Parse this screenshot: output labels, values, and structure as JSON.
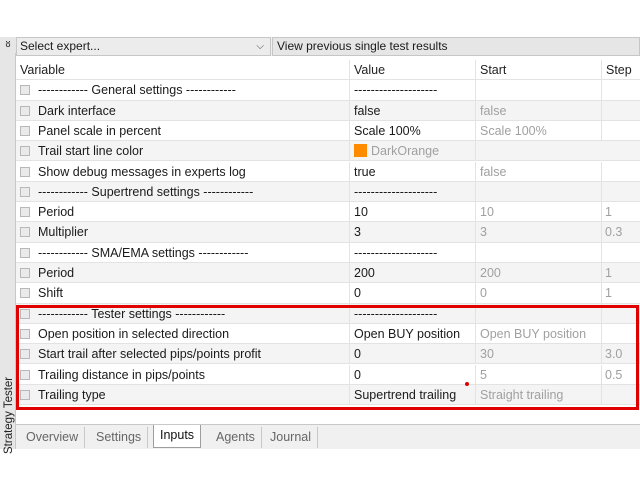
{
  "window": {
    "side_title": "Strategy Tester",
    "close_glyph": "ᴕ"
  },
  "toolbar": {
    "expert_select": "Select expert...",
    "view_results_button": "View previous single test results"
  },
  "table": {
    "headers": [
      "Variable",
      "Value",
      "Start",
      "Step"
    ],
    "rows": [
      {
        "variable": "------------ General settings ------------",
        "value": "--------------------",
        "start": "",
        "step": ""
      },
      {
        "variable": "Dark interface",
        "value": "false",
        "start": "false",
        "step": ""
      },
      {
        "variable": "Panel scale in percent",
        "value": "Scale 100%",
        "start": "Scale 100%",
        "step": ""
      },
      {
        "variable": "Trail start line color",
        "value": "",
        "start": "DarkOrange",
        "step": ""
      },
      {
        "variable": "Show debug messages in experts log",
        "value": "true",
        "start": "false",
        "step": ""
      },
      {
        "variable": "------------ Supertrend settings ------------",
        "value": "--------------------",
        "start": "",
        "step": ""
      },
      {
        "variable": "Period",
        "value": "10",
        "start": "10",
        "step": "1"
      },
      {
        "variable": "Multiplier",
        "value": "3",
        "start": "3",
        "step": "0.3"
      },
      {
        "variable": "------------ SMA/EMA settings ------------",
        "value": "--------------------",
        "start": "",
        "step": ""
      },
      {
        "variable": "Period",
        "value": "200",
        "start": "200",
        "step": "1"
      },
      {
        "variable": "Shift",
        "value": "0",
        "start": "0",
        "step": "1"
      },
      {
        "variable": "------------ Tester settings ------------",
        "value": "--------------------",
        "start": "",
        "step": ""
      },
      {
        "variable": "Open position in selected direction",
        "value": "Open BUY position",
        "start": "Open BUY position",
        "step": ""
      },
      {
        "variable": "Start trail after selected pips/points profit",
        "value": "0",
        "start": "30",
        "step": "3.0"
      },
      {
        "variable": "Trailing distance in pips/points",
        "value": "0",
        "start": "5",
        "step": "0.5"
      },
      {
        "variable": "Trailing type",
        "value": "Supertrend trailing",
        "start": "Straight trailing",
        "step": ""
      }
    ]
  },
  "colors": {
    "highlight_border": "#e00000",
    "dark_orange": "#ff8c00"
  },
  "tabs": [
    "Overview",
    "Settings",
    "Inputs",
    "Agents",
    "Journal"
  ],
  "active_tab": "Inputs"
}
